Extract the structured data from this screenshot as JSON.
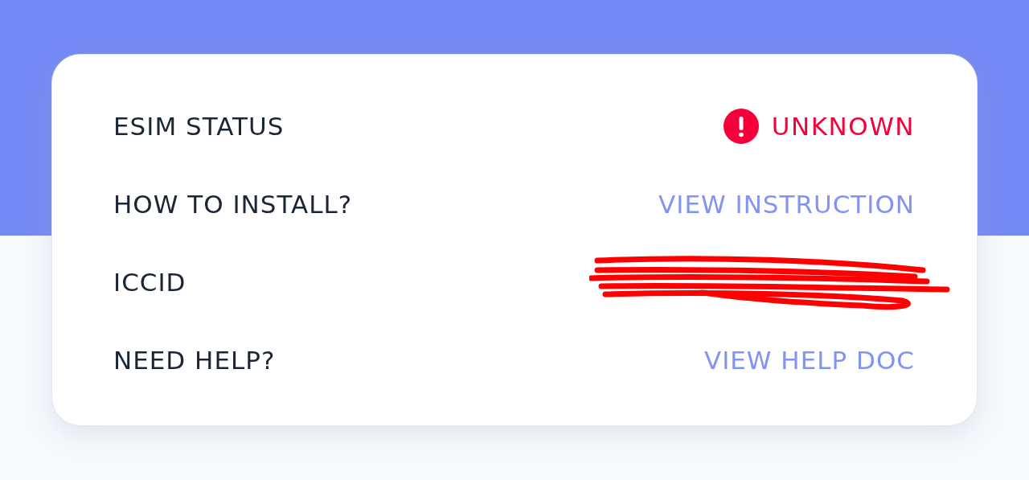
{
  "rows": [
    {
      "label": "ESIM STATUS",
      "kind": "status",
      "value": "UNKNOWN"
    },
    {
      "label": "HOW TO INSTALL?",
      "kind": "link",
      "value": "VIEW INSTRUCTION"
    },
    {
      "label": "ICCID",
      "kind": "redacted"
    },
    {
      "label": "NEED HELP?",
      "kind": "link",
      "value": "VIEW HELP DOC"
    }
  ]
}
